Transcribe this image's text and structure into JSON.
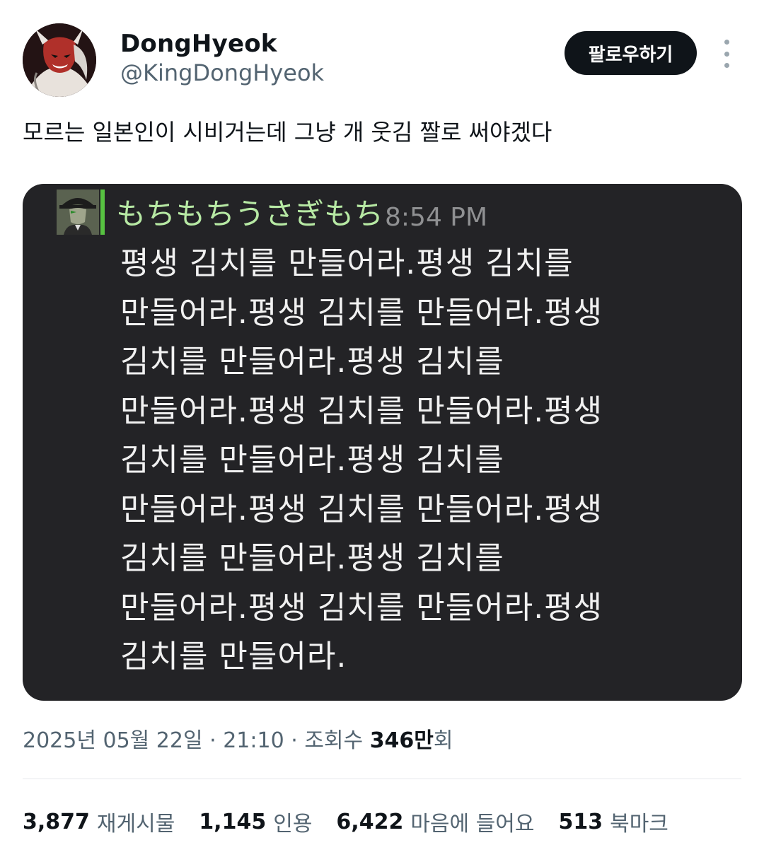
{
  "user": {
    "display_name": "DongHyeok",
    "handle": "@KingDongHyeok",
    "follow_label": "팔로우하기"
  },
  "tweet": {
    "text": "모르는 일본인이 시비거는데 그냥 개 웃김 짤로 써야겠다"
  },
  "media": {
    "author": "もちもちうさぎもち",
    "time": "8:54 PM",
    "lines": [
      "평생 김치를 만들어라.평생 김치를",
      "만들어라.평생 김치를 만들어라.평생",
      "김치를 만들어라.평생 김치를",
      "만들어라.평생 김치를 만들어라.평생",
      "김치를 만들어라.평생 김치를",
      "만들어라.평생 김치를 만들어라.평생",
      "김치를 만들어라.평생 김치를",
      "만들어라.평생 김치를 만들어라.평생",
      "김치를 만들어라."
    ]
  },
  "meta": {
    "date": "2025년 05월 22일",
    "separator": "·",
    "time": "21:10",
    "views_label": "조회수",
    "views_number": "346만",
    "views_suffix": "회"
  },
  "stats": [
    {
      "count": "3,877",
      "label": "재게시물"
    },
    {
      "count": "1,145",
      "label": "인용"
    },
    {
      "count": "6,422",
      "label": "마음에 들어요"
    },
    {
      "count": "513",
      "label": "북마크"
    }
  ],
  "colors": {
    "accent_green_bar": "#57c241",
    "author_green": "#b7e9a4",
    "card_bg": "#232326",
    "button_bg": "#0f1419",
    "muted_text": "#536471"
  },
  "icons": {
    "more": "more-vertical-icon"
  }
}
